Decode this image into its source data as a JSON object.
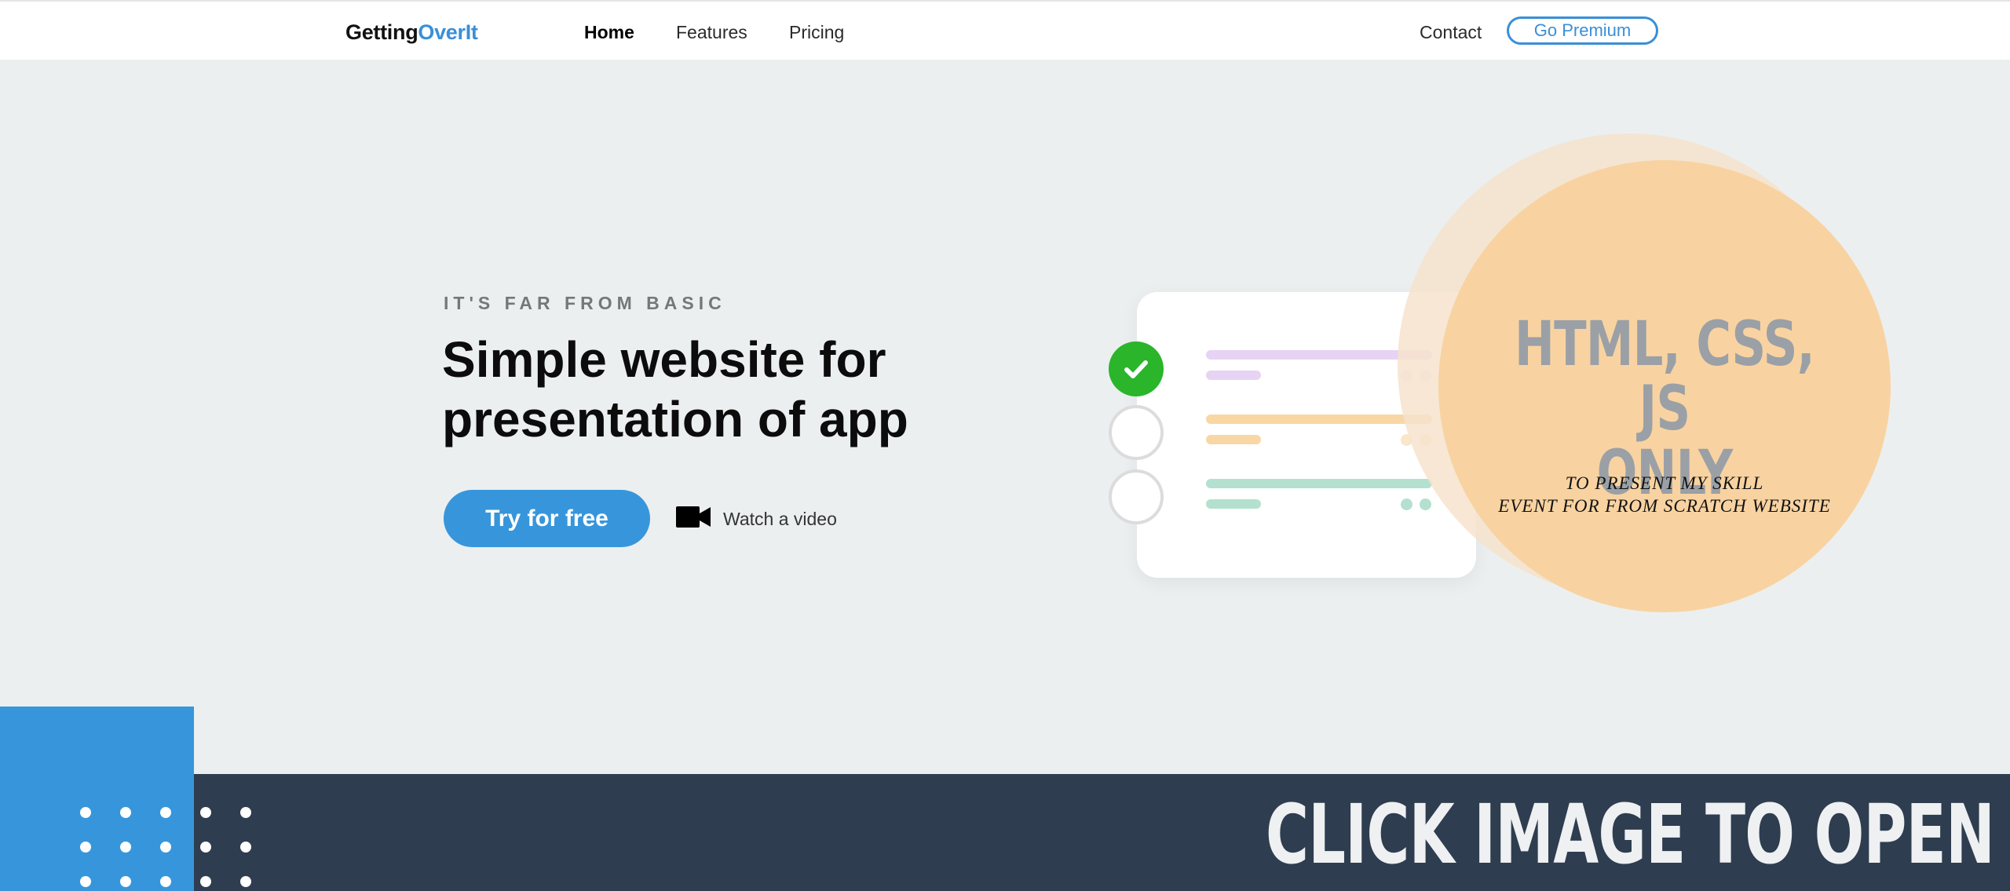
{
  "brand": {
    "part1": "Getting",
    "part2": "OverIt"
  },
  "nav": {
    "links": [
      "Home",
      "Features",
      "Pricing"
    ],
    "contact": "Contact",
    "premium": "Go Premium"
  },
  "hero": {
    "eyebrow": "IT'S FAR FROM BASIC",
    "headline_line1": "Simple website for",
    "headline_line2": "presentation of app",
    "cta": "Try for free",
    "video_label": "Watch a video",
    "video_icon": "video-camera-icon"
  },
  "promo": {
    "title_line1": "HTML, CSS, JS",
    "title_line2": "ONLY",
    "sub_line1": "TO PRESENT MY SKILL",
    "sub_line2": "EVENT FOR FROM SCRATCH WEBSITE"
  },
  "banner": {
    "text": "CLICK IMAGE TO OPEN"
  },
  "colors": {
    "accent": "#3796db",
    "check_done": "#2ab52a",
    "list_bar_1": "#e7d3f3",
    "list_bar_2": "#f8d7a5",
    "list_bar_3": "#b4e0cf",
    "dark_band": "#2e3d4f",
    "promo_circle": "#f8d3a1"
  }
}
